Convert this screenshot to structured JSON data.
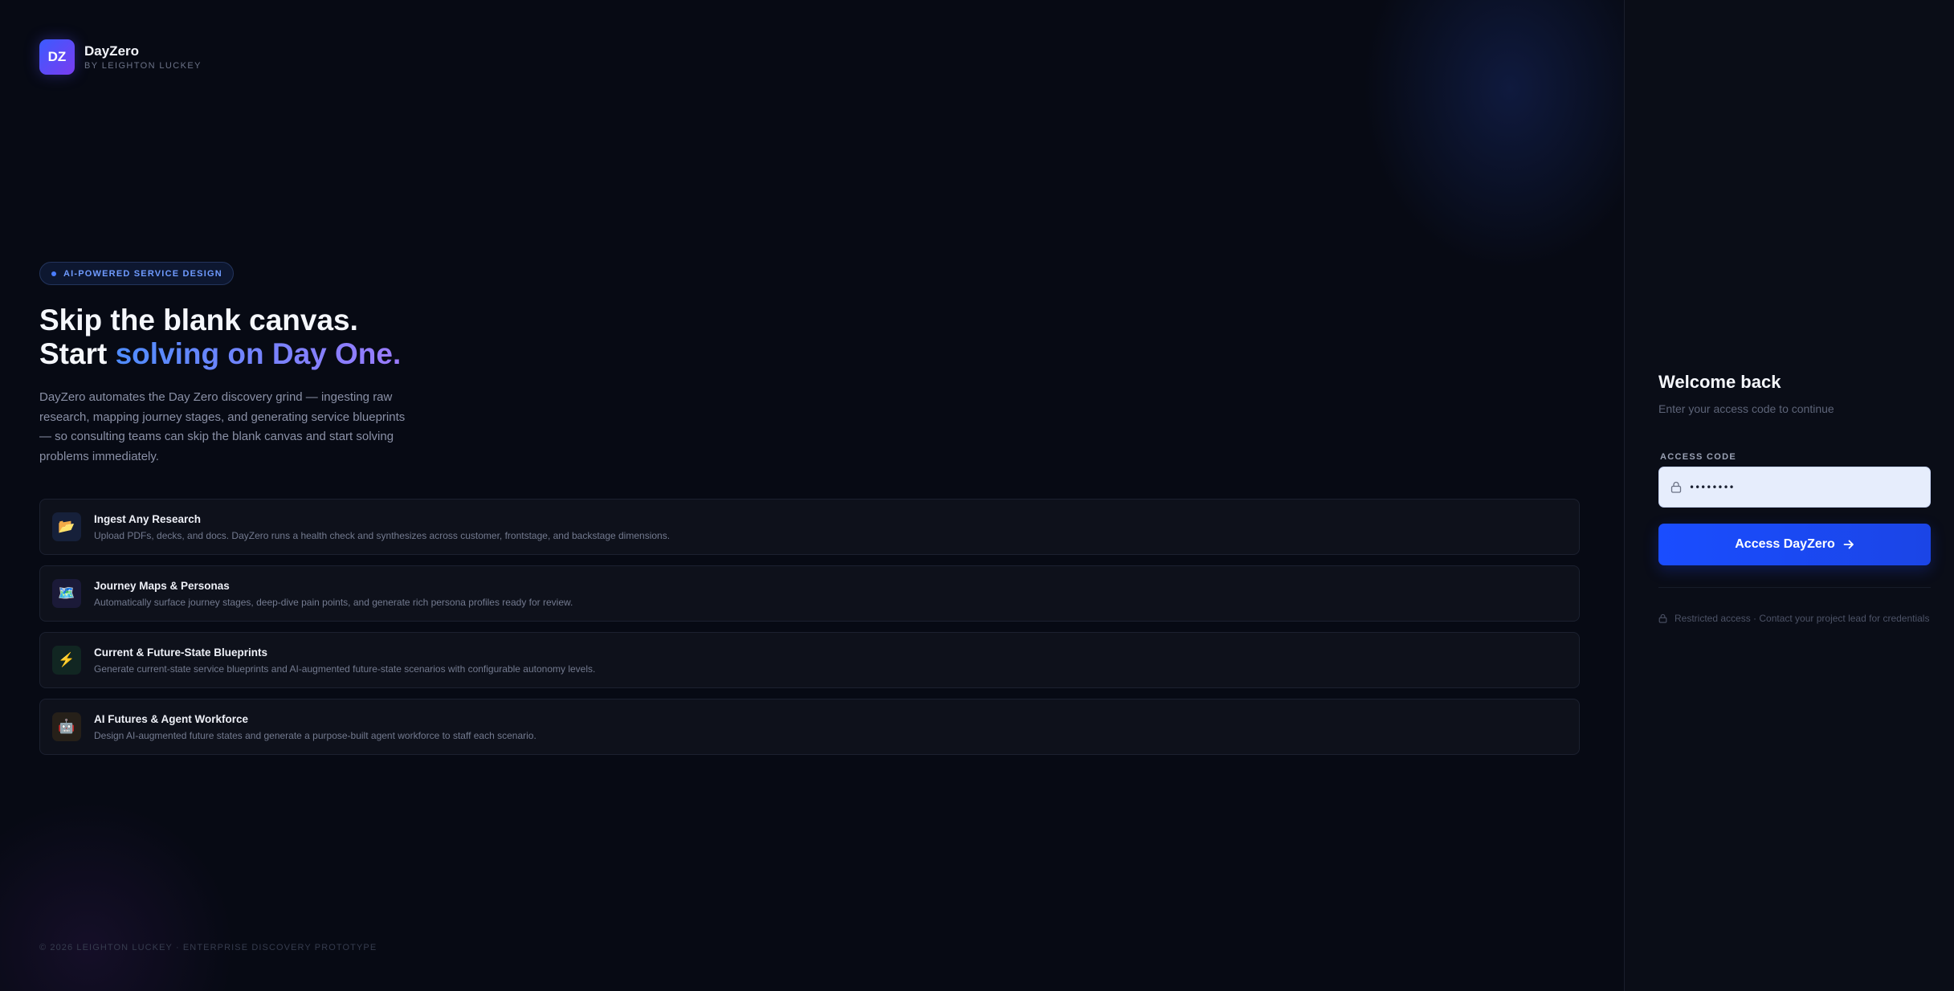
{
  "brand": {
    "logo_text": "DZ",
    "name": "DayZero",
    "byline": "BY LEIGHTON LUCKEY"
  },
  "hero": {
    "badge": "AI-POWERED SERVICE DESIGN",
    "headline_line1": "Skip the blank canvas.",
    "headline_line2_prefix": "Start ",
    "headline_line2_highlight": "solving on Day One.",
    "description": "DayZero automates the Day Zero discovery grind — ingesting raw research, mapping journey stages, and generating service blueprints — so consulting teams can skip the blank canvas and start solving problems immediately."
  },
  "features": [
    {
      "icon": "folder-icon",
      "glyph": "📂",
      "title": "Ingest Any Research",
      "description": "Upload PDFs, decks, and docs. DayZero runs a health check and synthesizes across customer, frontstage, and backstage dimensions."
    },
    {
      "icon": "map-icon",
      "glyph": "🗺️",
      "title": "Journey Maps & Personas",
      "description": "Automatically surface journey stages, deep-dive pain points, and generate rich persona profiles ready for review."
    },
    {
      "icon": "lightning-icon",
      "glyph": "⚡",
      "title": "Current & Future-State Blueprints",
      "description": "Generate current-state service blueprints and AI-augmented future-state scenarios with configurable autonomy levels."
    },
    {
      "icon": "robot-icon",
      "glyph": "🤖",
      "title": "AI Futures & Agent Workforce",
      "description": "Design AI-augmented future states and generate a purpose-built agent workforce to staff each scenario."
    }
  ],
  "footer": {
    "text": "© 2026 LEIGHTON LUCKEY · ENTERPRISE DISCOVERY PROTOTYPE"
  },
  "login": {
    "title": "Welcome back",
    "subtitle": "Enter your access code to continue",
    "field_label": "ACCESS CODE",
    "code_value": "••••••••",
    "button_label": "Access DayZero",
    "restricted_note": "Restricted access · Contact your project lead for credentials"
  },
  "colors": {
    "background": "#070a14",
    "accent": "#1a4dff",
    "gradient_start": "#4f8cff",
    "gradient_end": "#9b7bff"
  }
}
